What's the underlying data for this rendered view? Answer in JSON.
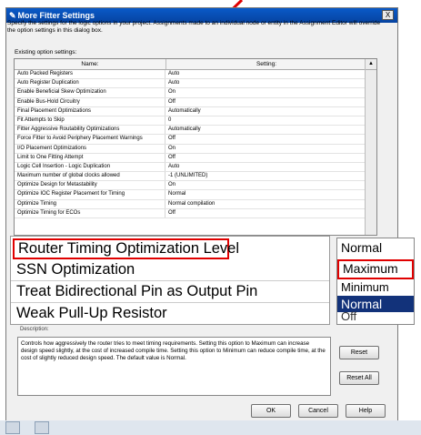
{
  "dialog": {
    "title": "More Fitter Settings",
    "close_label": "X",
    "description": "Specify the settings for the logic options in your project.  Assignments made to an individual node or entity in the Assignment Editor will override the option settings in this dialog box.",
    "existing_label": "Existing option settings:"
  },
  "table": {
    "headers": {
      "name": "Name:",
      "setting": "Setting:"
    },
    "rows": [
      {
        "name": "Auto Packed Registers",
        "setting": "Auto"
      },
      {
        "name": "Auto Register Duplication",
        "setting": "Auto"
      },
      {
        "name": "Enable Beneficial Skew Optimization",
        "setting": "On"
      },
      {
        "name": "Enable Bus-Hold Circuitry",
        "setting": "Off"
      },
      {
        "name": "Final Placement Optimizations",
        "setting": "Automatically"
      },
      {
        "name": "Fit Attempts to Skip",
        "setting": "0"
      },
      {
        "name": "Fitter Aggressive Routability Optimizations",
        "setting": "Automatically"
      },
      {
        "name": "Force Fitter to Avoid Periphery Placement Warnings",
        "setting": "Off"
      },
      {
        "name": "I/O Placement Optimizations",
        "setting": "On"
      },
      {
        "name": "Limit to One Fitting Attempt",
        "setting": "Off"
      },
      {
        "name": "Logic Cell Insertion - Logic Duplication",
        "setting": "Auto"
      },
      {
        "name": "Maximum number of global clocks allowed",
        "setting": "-1 (UNLIMITED)"
      },
      {
        "name": "Optimize Design for Metastability",
        "setting": "On"
      },
      {
        "name": "Optimize IOC Register Placement for Timing",
        "setting": "Normal"
      },
      {
        "name": "Optimize Timing",
        "setting": "Normal compilation"
      },
      {
        "name": "Optimize Timing for ECOs",
        "setting": "Off"
      }
    ]
  },
  "zoom": {
    "rows": [
      "Router Timing Optimization Level",
      "SSN Optimization",
      "Treat Bidirectional Pin as Output Pin",
      "Weak Pull-Up Resistor"
    ],
    "dropdown": {
      "current": "Normal",
      "options": [
        "Maximum",
        "Minimum",
        "Normal"
      ],
      "underneath": "Off"
    }
  },
  "description_box": {
    "title": "Description:",
    "text": "Controls how aggressively the router tries to meet timing requirements. Setting this option to Maximum can increase design speed slightly, at the cost of increased compile time.  Setting this option to Minimum can reduce compile time, at the cost of slightly reduced design speed. The default value is Normal."
  },
  "buttons": {
    "reset": "Reset",
    "reset_all": "Reset All",
    "ok": "OK",
    "cancel": "Cancel",
    "help": "Help"
  },
  "colors": {
    "highlight_red": "#e00000",
    "selection_blue": "#12327a",
    "title_blue": "#0a5ac8"
  }
}
